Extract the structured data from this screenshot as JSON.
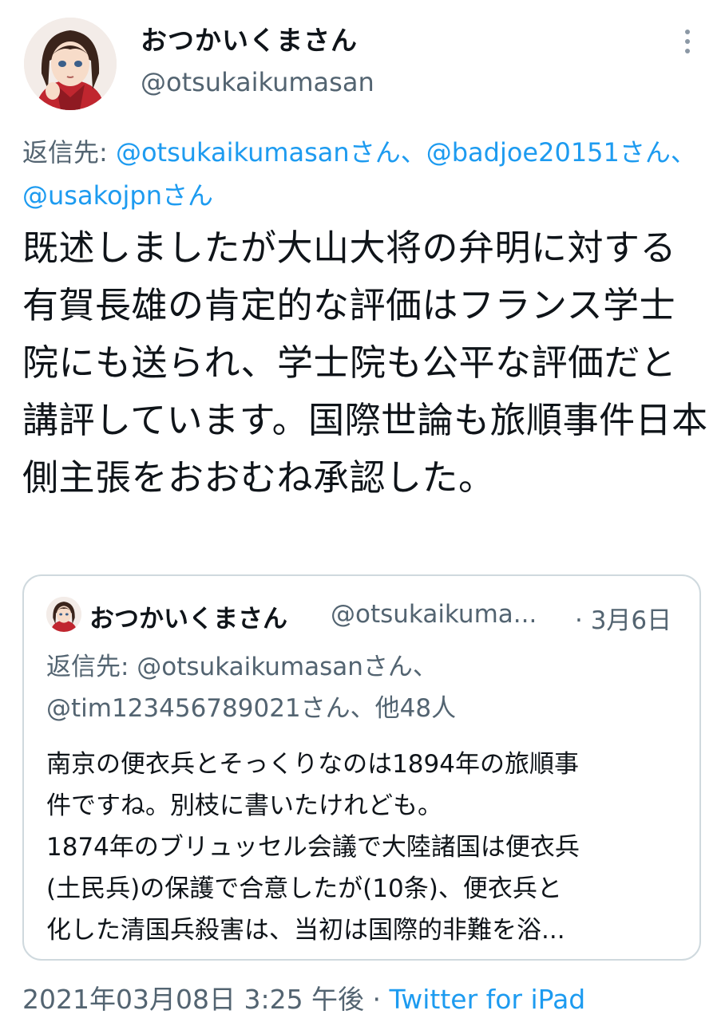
{
  "author": {
    "display_name": "おつかいくまさん",
    "handle": "@otsukaikumasan",
    "avatar_icon": "profile-avatar-anime-girl"
  },
  "menu_icon": "more-vertical-icon",
  "reply_to": {
    "prefix": "返信先: ",
    "mention_1": "@otsukaikumasanさん、",
    "mention_2": "@badjoe20151さん、",
    "mention_3": "@usakojpnさん"
  },
  "tweet_text": "既述しましたが大山大将の弁明に対する有賀長雄の肯定的な評価はフランス学士院にも送られ、学士院も公平な評価だと講評しています。国際世論も旅順事件日本側主張をおおむね承認した。",
  "quoted_tweet": {
    "display_name": "おつかいくまさん",
    "handle": "@otsukaikuma...",
    "date": "· 3月6日",
    "reply_to": "返信先: @otsukaikumasanさん、@tim123456789021さん、他48人",
    "lines": [
      "南京の便衣兵とそっくりなのは1894年の旅順事",
      "件ですね。別枝に書いたけれども。",
      "1874年のブリュッセル会議で大陸諸国は便衣兵",
      "(土民兵)の保護で合意したが(10条)、便衣兵と",
      "化した清国兵殺害は、当初は国際的非難を浴..."
    ]
  },
  "timestamp": "2021年03月08日 3:25 午後 · ",
  "source": "Twitter for iPad",
  "colors": {
    "link": "#1d9bf0",
    "muted": "#536471",
    "border": "#cfd9de"
  }
}
